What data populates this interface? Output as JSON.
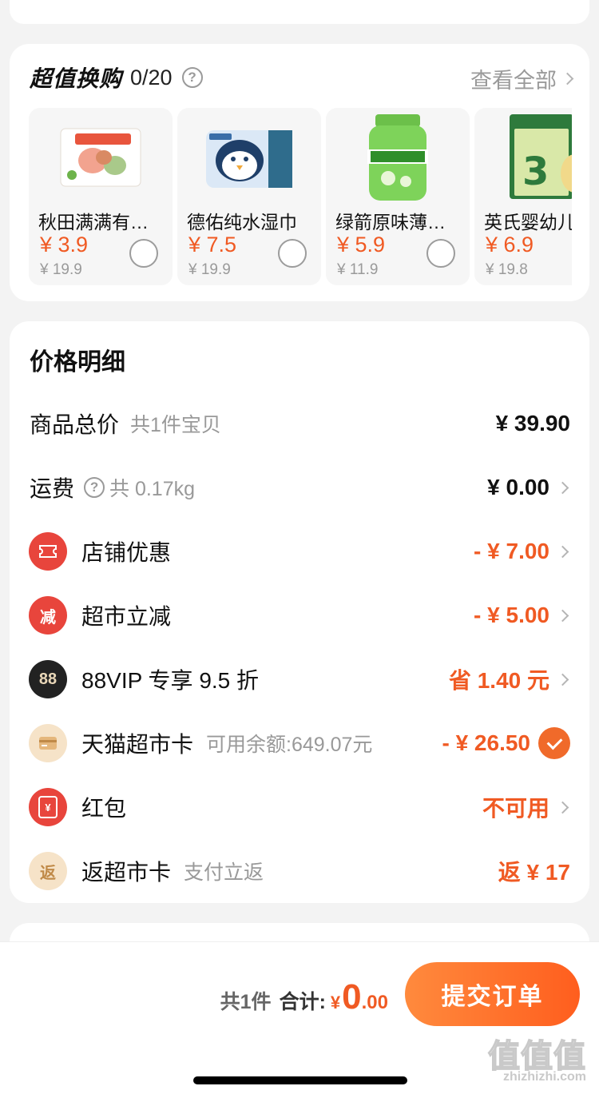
{
  "exchange": {
    "title": "超值换购",
    "count": "0/20",
    "help_icon": "?",
    "view_all": "查看全部",
    "items": [
      {
        "name": "秋田满满有机婴幼儿混合细粥",
        "price": "¥ 3.9",
        "orig": "¥ 19.9"
      },
      {
        "name": "德佑纯水湿巾",
        "price": "¥ 7.5",
        "orig": "¥ 19.9"
      },
      {
        "name": "绿箭原味薄荷糖",
        "price": "¥ 5.9",
        "orig": "¥ 11.9"
      },
      {
        "name": "英氏婴幼儿米饼",
        "price": "¥ 6.9",
        "orig": "¥ 19.8"
      }
    ]
  },
  "detail": {
    "title": "价格明细",
    "rows": {
      "goods": {
        "label": "商品总价",
        "sub": "共1件宝贝",
        "value": "¥ 39.90"
      },
      "shipping": {
        "label": "运费",
        "sub": "共 0.17kg",
        "value": "¥ 0.00"
      },
      "shop": {
        "label": "店铺优惠",
        "value": "- ¥ 7.00"
      },
      "market": {
        "label": "超市立减",
        "icon_text": "减",
        "value": "- ¥ 5.00"
      },
      "vip": {
        "label": "88VIP 专享 9.5 折",
        "icon_text": "88",
        "value": "省 1.40 元"
      },
      "card": {
        "label": "天猫超市卡",
        "sub": "可用余额:649.07元",
        "value": "- ¥ 26.50"
      },
      "redpack": {
        "label": "红包",
        "icon_text": "¥",
        "value": "不可用"
      },
      "rebate": {
        "label": "返超市卡",
        "icon_text": "返",
        "sub": "支付立返",
        "value": "返 ¥ 17"
      }
    }
  },
  "footer": {
    "count": "共1件",
    "total_label": "合计:",
    "currency": "¥",
    "total_int": "0",
    "total_dec": ".00",
    "submit": "提交订单"
  },
  "watermark": {
    "zh": "值值值",
    "en": "zhizhizhi.com"
  },
  "colors": {
    "accent": "#f05a23",
    "background": "#f3f3f3",
    "card": "#ffffff"
  }
}
